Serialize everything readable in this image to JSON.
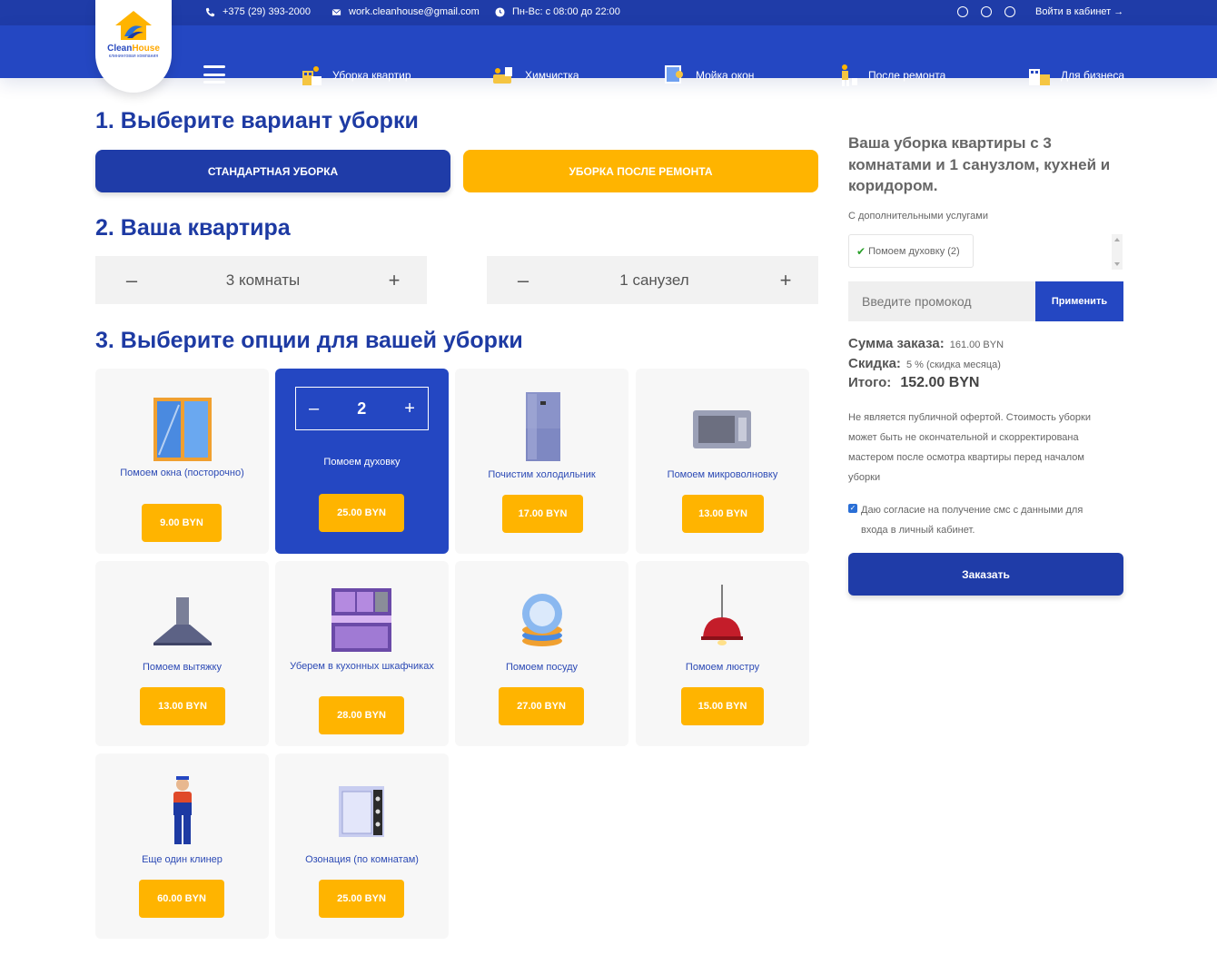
{
  "topbar": {
    "phone": "+375 (29) 393-2000",
    "email": "work.cleanhouse@gmail.com",
    "hours": "Пн-Вс: с 08:00 до 22:00",
    "login": "Войти в кабинет →"
  },
  "logo": {
    "name_part1": "Clean",
    "name_part2": "House",
    "subtitle": "клининговая компания"
  },
  "nav": {
    "items": [
      {
        "label": "Уборка квартир",
        "icon": "apartment-cleaning-icon"
      },
      {
        "label": "Химчистка",
        "icon": "dry-cleaning-icon"
      },
      {
        "label": "Мойка окон",
        "icon": "window-washing-icon"
      },
      {
        "label": "После ремонта",
        "icon": "post-renovation-icon"
      },
      {
        "label": "Для бизнеса",
        "icon": "business-icon"
      }
    ]
  },
  "step1": {
    "title": "1. Выберите вариант уборки",
    "standard": "Стандартная уборка",
    "after_repair": "Уборка после ремонта"
  },
  "step2": {
    "title": "2. Ваша квартира",
    "rooms": "3 комнаты",
    "bathrooms": "1 санузел",
    "minus": "–",
    "plus": "+"
  },
  "step3": {
    "title": "3. Выберите опции для вашей уборки",
    "options": [
      {
        "label": "Помоем окна (посторочно)",
        "price": "9.00 BYN",
        "icon": "window-icon"
      },
      {
        "label": "Помоем духовку",
        "price": "25.00 BYN",
        "icon": "oven-icon",
        "qty": "2"
      },
      {
        "label": "Почистим холодильник",
        "price": "17.00 BYN",
        "icon": "fridge-icon"
      },
      {
        "label": "Помоем микроволновку",
        "price": "13.00 BYN",
        "icon": "microwave-icon"
      },
      {
        "label": "Помоем вытяжку",
        "price": "13.00 BYN",
        "icon": "hood-icon"
      },
      {
        "label": "Уберем в кухонных шкафчиках",
        "price": "28.00 BYN",
        "icon": "kitchen-cabinet-icon"
      },
      {
        "label": "Помоем посуду",
        "price": "27.00 BYN",
        "icon": "dishes-icon"
      },
      {
        "label": "Помоем люстру",
        "price": "15.00 BYN",
        "icon": "chandelier-icon"
      },
      {
        "label": "Еще один клинер",
        "price": "60.00 BYN",
        "icon": "cleaner-icon"
      },
      {
        "label": "Озонация (по комнатам)",
        "price": "25.00 BYN",
        "icon": "ozonator-icon"
      }
    ]
  },
  "summary": {
    "title": "Ваша уборка квартиры с 3 комнатами и 1 санузлом, кухней и коридором.",
    "extras_label": "С дополнительными услугами",
    "extra_item": "Помоем духовку (2)",
    "promo_placeholder": "Введите промокод",
    "apply": "Применить",
    "order_sum_label": "Сумма заказа:",
    "order_sum": "161.00 BYN",
    "discount_label": "Скидка:",
    "discount": "5 % (скидка месяца)",
    "total_label": "Итого:",
    "total": "152.00 BYN",
    "note": "Не является публичной офертой. Стоимость уборки может быть не окончательной и скорректирована мастером после осмотра квартиры перед началом уборки",
    "consent": "Даю согласие на получение смс с данными для входа в личный кабинет.",
    "order_button": "Заказать"
  },
  "colors": {
    "brand_blue": "#1f3ca8",
    "nav_blue": "#2447c2",
    "accent_yellow": "#ffb400"
  }
}
